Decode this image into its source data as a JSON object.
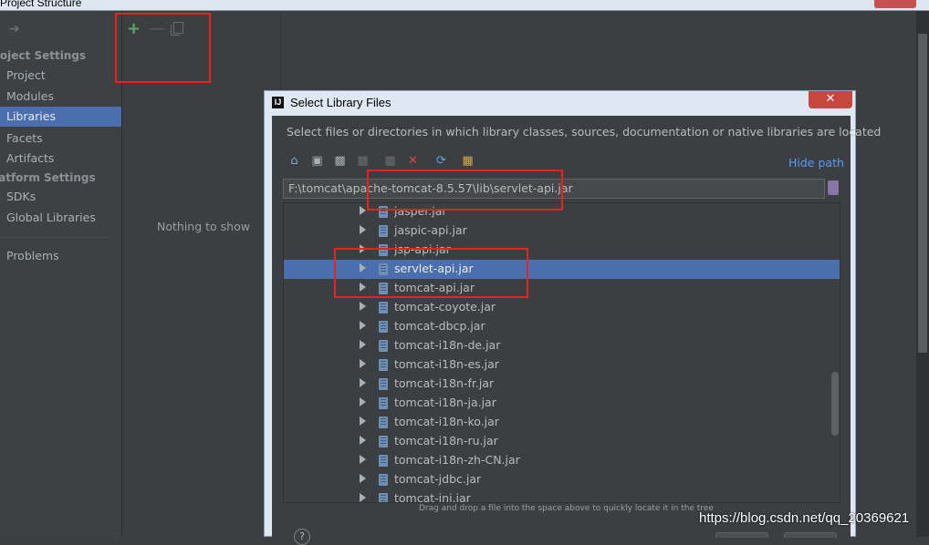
{
  "window": {
    "title": "Project Structure"
  },
  "sidebar": {
    "sections": [
      {
        "label": "roject Settings"
      },
      {
        "label": "latform Settings"
      }
    ],
    "items": [
      {
        "label": "Project"
      },
      {
        "label": "Modules"
      },
      {
        "label": "Libraries",
        "selected": true
      },
      {
        "label": "Facets"
      },
      {
        "label": "Artifacts"
      },
      {
        "label": "SDKs"
      },
      {
        "label": "Global Libraries"
      },
      {
        "label": "Problems"
      }
    ]
  },
  "middle": {
    "toolbar": {
      "add_icon": "plus-icon",
      "remove_icon": "minus-icon",
      "copy_icon": "copy-icon"
    },
    "empty_text": "Nothing to show"
  },
  "dialog": {
    "title": "Select Library Files",
    "logo_text": "IJ",
    "description": "Select files or directories in which library classes, sources, documentation or native libraries are located",
    "toolbar_icons": [
      "home-icon",
      "desktop-icon",
      "project-folder-icon",
      "module-folder-icon",
      "new-folder-icon",
      "delete-icon",
      "refresh-icon",
      "show-hidden-icon"
    ],
    "hide_path": "Hide path",
    "path": "F:\\tomcat\\apache-tomcat-8.5.57\\lib\\servlet-api.jar",
    "tree_items": [
      {
        "name": "jasper.jar"
      },
      {
        "name": "jaspic-api.jar"
      },
      {
        "name": "jsp-api.jar"
      },
      {
        "name": "servlet-api.jar",
        "selected": true
      },
      {
        "name": "tomcat-api.jar"
      },
      {
        "name": "tomcat-coyote.jar"
      },
      {
        "name": "tomcat-dbcp.jar"
      },
      {
        "name": "tomcat-i18n-de.jar"
      },
      {
        "name": "tomcat-i18n-es.jar"
      },
      {
        "name": "tomcat-i18n-fr.jar"
      },
      {
        "name": "tomcat-i18n-ja.jar"
      },
      {
        "name": "tomcat-i18n-ko.jar"
      },
      {
        "name": "tomcat-i18n-ru.jar"
      },
      {
        "name": "tomcat-i18n-zh-CN.jar"
      },
      {
        "name": "tomcat-jdbc.jar"
      },
      {
        "name": "tomcat-jni.jar"
      }
    ],
    "hint": "Drag and drop a file into the space above to quickly locate it in the tree",
    "help_label": "?"
  },
  "watermark": "https://blog.csdn.net/qq_20369621",
  "colors": {
    "selection": "#4b6eaf",
    "highlight": "#e8221c",
    "link": "#589df6"
  }
}
